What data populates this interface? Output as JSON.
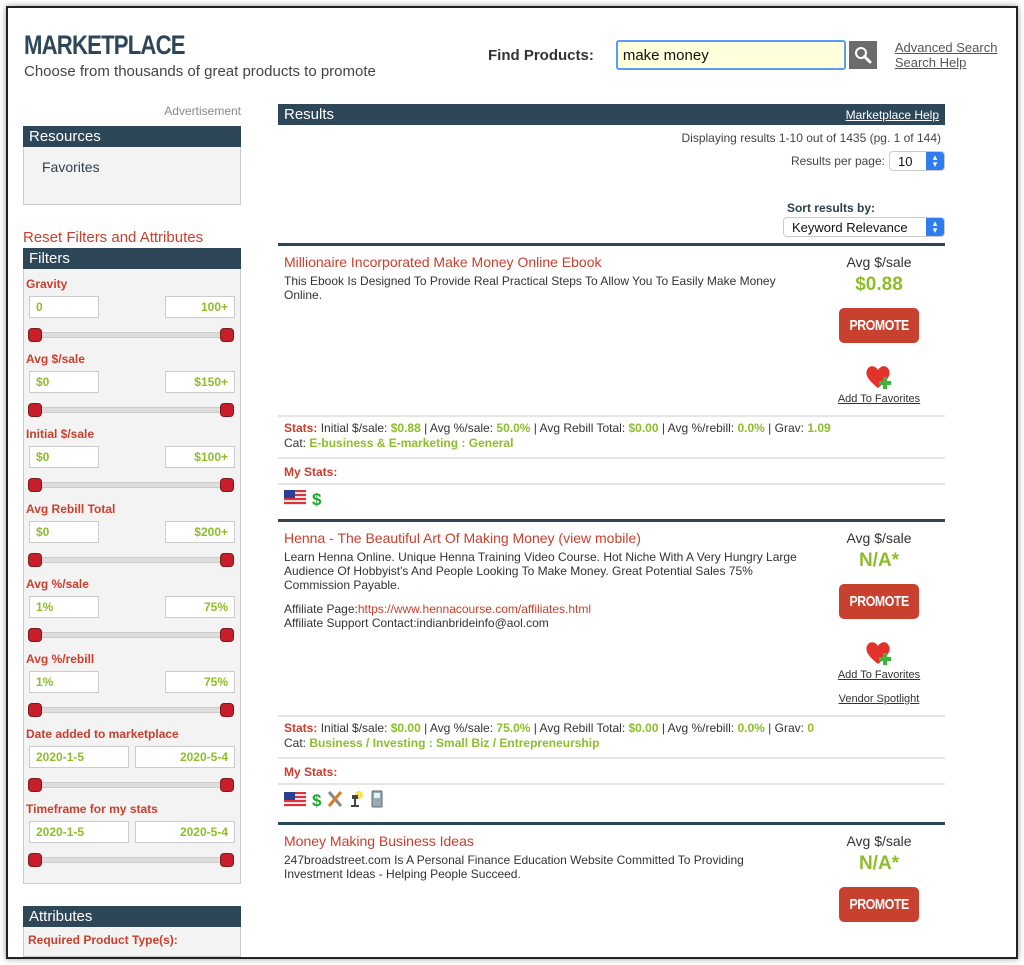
{
  "header": {
    "title": "MARKETPLACE",
    "subtitle": "Choose from thousands of great products to promote"
  },
  "search": {
    "label": "Find Products:",
    "value": "make money",
    "advanced_link": "Advanced Search",
    "help_link": "Search Help"
  },
  "sidebar": {
    "ad_label": "Advertisement",
    "resources": {
      "title": "Resources",
      "items": [
        "Favorites"
      ]
    },
    "reset_link": "Reset Filters and Attributes",
    "filters": {
      "title": "Filters",
      "items": [
        {
          "label": "Gravity",
          "min": "0",
          "max": "100+"
        },
        {
          "label": "Avg $/sale",
          "min": "$0",
          "max": "$150+"
        },
        {
          "label": "Initial $/sale",
          "min": "$0",
          "max": "$100+"
        },
        {
          "label": "Avg Rebill Total",
          "min": "$0",
          "max": "$200+"
        },
        {
          "label": "Avg %/sale",
          "min": "1%",
          "max": "75%"
        },
        {
          "label": "Avg %/rebill",
          "min": "1%",
          "max": "75%"
        },
        {
          "label": "Date added to marketplace",
          "min": "2020-1-5",
          "max": "2020-5-4"
        },
        {
          "label": "Timeframe for my stats",
          "min": "2020-1-5",
          "max": "2020-5-4"
        }
      ]
    },
    "attributes": {
      "title": "Attributes",
      "first_label": "Required Product Type(s):"
    }
  },
  "results": {
    "title": "Results",
    "help_link": "Marketplace Help",
    "displaying": "Displaying results 1-10 out of 1435 (pg. 1 of 144)",
    "per_page_label": "Results per page:",
    "per_page_value": "10",
    "sort_label": "Sort results by:",
    "sort_value": "Keyword Relevance",
    "avg_label": "Avg $/sale",
    "promote_label": "PROMOTE",
    "add_favorites": "Add To Favorites",
    "vendor_spotlight": "Vendor Spotlight",
    "stats_prefix": "Stats:",
    "my_stats": "My Stats:",
    "products": [
      {
        "title": "Millionaire Incorporated Make Money Online Ebook",
        "description": "This Ebook Is Designed To Provide Real Practical Steps To Allow You To Easily Make Money Online.",
        "avg_sale": "$0.88",
        "initial_sale": "$0.88",
        "avg_pct_sale": "50.0%",
        "avg_rebill_total": "$0.00",
        "avg_pct_rebill": "0.0%",
        "grav": "1.09",
        "category": "E-business & E-marketing : General",
        "icons": [
          "us-flag-icon",
          "dollar-icon"
        ]
      },
      {
        "title": "Henna - The Beautiful Art Of Making Money (view mobile)",
        "description": "Learn Henna Online. Unique Henna Training Video Course. Hot Niche With A Very Hungry Large Audience Of Hobbyist's And People Looking To Make Money. Great Potential Sales 75% Commission Payable.",
        "affiliate_page_label": "Affiliate Page:",
        "affiliate_page_url": "https://www.hennacourse.com/affiliates.html",
        "affiliate_contact_label": "Affiliate Support Contact:",
        "affiliate_contact": "indianbrideinfo@aol.com",
        "avg_sale": "N/A*",
        "initial_sale": "$0.00",
        "avg_pct_sale": "75.0%",
        "avg_rebill_total": "$0.00",
        "avg_pct_rebill": "0.0%",
        "grav": "0",
        "category": "Business / Investing : Small Biz / Entrepreneurship",
        "icons": [
          "us-flag-icon",
          "dollar-icon",
          "tools-icon",
          "spotlight-icon",
          "mobile-icon"
        ]
      },
      {
        "title": "Money Making Business Ideas",
        "description": "247broadstreet.com Is A Personal Finance Education Website Committed To Providing Investment Ideas - Helping People Succeed.",
        "avg_sale": "N/A*"
      }
    ],
    "stat_labels": {
      "initial": "Initial $/sale:",
      "avg_pct_sale": "Avg %/sale:",
      "avg_rebill_total": "Avg Rebill Total:",
      "avg_pct_rebill": "Avg %/rebill:",
      "grav": "Grav:",
      "cat": "Cat:"
    }
  },
  "colors": {
    "navy": "#2d4658",
    "accent_red": "#c8402e",
    "value_green": "#8dbe2a"
  }
}
